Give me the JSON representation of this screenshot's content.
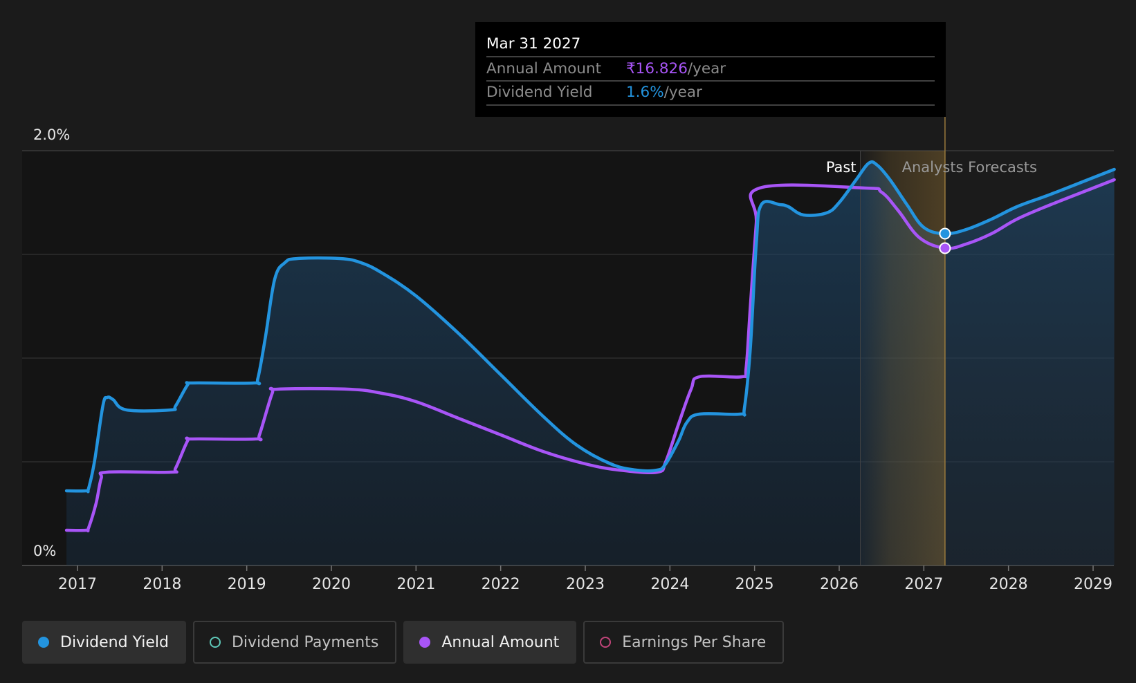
{
  "tooltip": {
    "date": "Mar 31 2027",
    "rows": [
      {
        "label": "Annual Amount",
        "value": "₹16.826",
        "unit": "/year",
        "color": "#a855f7"
      },
      {
        "label": "Dividend Yield",
        "value": "1.6%",
        "unit": "/year",
        "color": "#2394df"
      }
    ]
  },
  "regions": {
    "past_label": "Past",
    "forecast_label": "Analysts Forecasts"
  },
  "legend": [
    {
      "label": "Dividend Yield",
      "color": "#2394df",
      "active": true,
      "icon": "filled-circle-icon"
    },
    {
      "label": "Dividend Payments",
      "color": "#5fc9b9",
      "active": false,
      "icon": "hollow-circle-icon"
    },
    {
      "label": "Annual Amount",
      "color": "#a855f7",
      "active": true,
      "icon": "filled-circle-icon"
    },
    {
      "label": "Earnings Per Share",
      "color": "#c2457a",
      "active": false,
      "icon": "hollow-circle-icon"
    }
  ],
  "colors": {
    "background": "#1b1b1b",
    "plot_background": "#141414",
    "dividend_yield": "#2394df",
    "annual_amount": "#a855f7",
    "gridline": "#3a3a3a",
    "forecast_band": "#8a6a30"
  },
  "chart_data": {
    "type": "line",
    "title": "",
    "xlabel": "",
    "ylabel": "",
    "x_ticks": [
      "2017",
      "2018",
      "2019",
      "2020",
      "2021",
      "2022",
      "2023",
      "2024",
      "2025",
      "2026",
      "2027",
      "2028",
      "2029"
    ],
    "y_tick_labels": [
      "0%",
      "2.0%"
    ],
    "ylim": [
      0,
      2.0
    ],
    "xlim": [
      2016.35,
      2029.25
    ],
    "grid": true,
    "past_forecast_boundary": 2026.25,
    "highlight_x": 2027.25,
    "series": [
      {
        "name": "Dividend Yield",
        "unit": "%",
        "color": "#2394df",
        "fill": true,
        "points": [
          [
            2016.87,
            0.36
          ],
          [
            2017.1,
            0.36
          ],
          [
            2017.13,
            0.37
          ],
          [
            2017.2,
            0.5
          ],
          [
            2017.3,
            0.77
          ],
          [
            2017.35,
            0.81
          ],
          [
            2017.42,
            0.8
          ],
          [
            2017.58,
            0.75
          ],
          [
            2018.1,
            0.75
          ],
          [
            2018.16,
            0.77
          ],
          [
            2018.3,
            0.87
          ],
          [
            2018.36,
            0.88
          ],
          [
            2019.08,
            0.88
          ],
          [
            2019.13,
            0.9
          ],
          [
            2019.22,
            1.1
          ],
          [
            2019.33,
            1.38
          ],
          [
            2019.45,
            1.46
          ],
          [
            2019.6,
            1.48
          ],
          [
            2020.1,
            1.48
          ],
          [
            2020.35,
            1.46
          ],
          [
            2020.6,
            1.41
          ],
          [
            2021.0,
            1.3
          ],
          [
            2021.5,
            1.12
          ],
          [
            2022.0,
            0.92
          ],
          [
            2022.5,
            0.72
          ],
          [
            2022.9,
            0.58
          ],
          [
            2023.3,
            0.49
          ],
          [
            2023.6,
            0.46
          ],
          [
            2023.85,
            0.46
          ],
          [
            2023.95,
            0.49
          ],
          [
            2024.1,
            0.6
          ],
          [
            2024.2,
            0.69
          ],
          [
            2024.35,
            0.73
          ],
          [
            2024.83,
            0.73
          ],
          [
            2024.88,
            0.76
          ],
          [
            2024.95,
            1.05
          ],
          [
            2025.02,
            1.55
          ],
          [
            2025.08,
            1.74
          ],
          [
            2025.3,
            1.74
          ],
          [
            2025.4,
            1.73
          ],
          [
            2025.58,
            1.69
          ],
          [
            2025.85,
            1.7
          ],
          [
            2026.0,
            1.75
          ],
          [
            2026.2,
            1.86
          ],
          [
            2026.35,
            1.94
          ],
          [
            2026.45,
            1.93
          ],
          [
            2026.6,
            1.86
          ],
          [
            2026.8,
            1.74
          ],
          [
            2027.0,
            1.63
          ],
          [
            2027.25,
            1.6
          ],
          [
            2027.5,
            1.62
          ],
          [
            2027.8,
            1.67
          ],
          [
            2028.1,
            1.73
          ],
          [
            2028.5,
            1.79
          ],
          [
            2029.0,
            1.87
          ],
          [
            2029.25,
            1.91
          ]
        ]
      },
      {
        "name": "Annual Amount",
        "unit": "₹",
        "color": "#a855f7",
        "fill": false,
        "points": [
          [
            2016.87,
            0.17
          ],
          [
            2017.1,
            0.17
          ],
          [
            2017.13,
            0.18
          ],
          [
            2017.22,
            0.3
          ],
          [
            2017.28,
            0.42
          ],
          [
            2017.35,
            0.45
          ],
          [
            2018.1,
            0.45
          ],
          [
            2018.16,
            0.47
          ],
          [
            2018.3,
            0.6
          ],
          [
            2018.36,
            0.61
          ],
          [
            2019.1,
            0.61
          ],
          [
            2019.15,
            0.63
          ],
          [
            2019.3,
            0.83
          ],
          [
            2019.36,
            0.85
          ],
          [
            2020.2,
            0.85
          ],
          [
            2020.6,
            0.83
          ],
          [
            2021.0,
            0.79
          ],
          [
            2021.5,
            0.71
          ],
          [
            2022.0,
            0.63
          ],
          [
            2022.5,
            0.55
          ],
          [
            2023.0,
            0.49
          ],
          [
            2023.4,
            0.46
          ],
          [
            2023.85,
            0.45
          ],
          [
            2023.95,
            0.5
          ],
          [
            2024.1,
            0.68
          ],
          [
            2024.25,
            0.85
          ],
          [
            2024.35,
            0.91
          ],
          [
            2024.85,
            0.91
          ],
          [
            2024.9,
            0.95
          ],
          [
            2024.95,
            1.25
          ],
          [
            2025.02,
            1.65
          ],
          [
            2025.06,
            1.82
          ],
          [
            2026.3,
            1.82
          ],
          [
            2026.5,
            1.8
          ],
          [
            2026.7,
            1.71
          ],
          [
            2026.95,
            1.58
          ],
          [
            2027.25,
            1.53
          ],
          [
            2027.5,
            1.55
          ],
          [
            2027.8,
            1.6
          ],
          [
            2028.1,
            1.67
          ],
          [
            2028.5,
            1.74
          ],
          [
            2029.0,
            1.82
          ],
          [
            2029.25,
            1.86
          ]
        ]
      }
    ],
    "highlight_points": [
      {
        "series": "Dividend Yield",
        "x": 2027.25,
        "y": 1.6
      },
      {
        "series": "Annual Amount",
        "x": 2027.25,
        "y": 1.53
      }
    ]
  }
}
